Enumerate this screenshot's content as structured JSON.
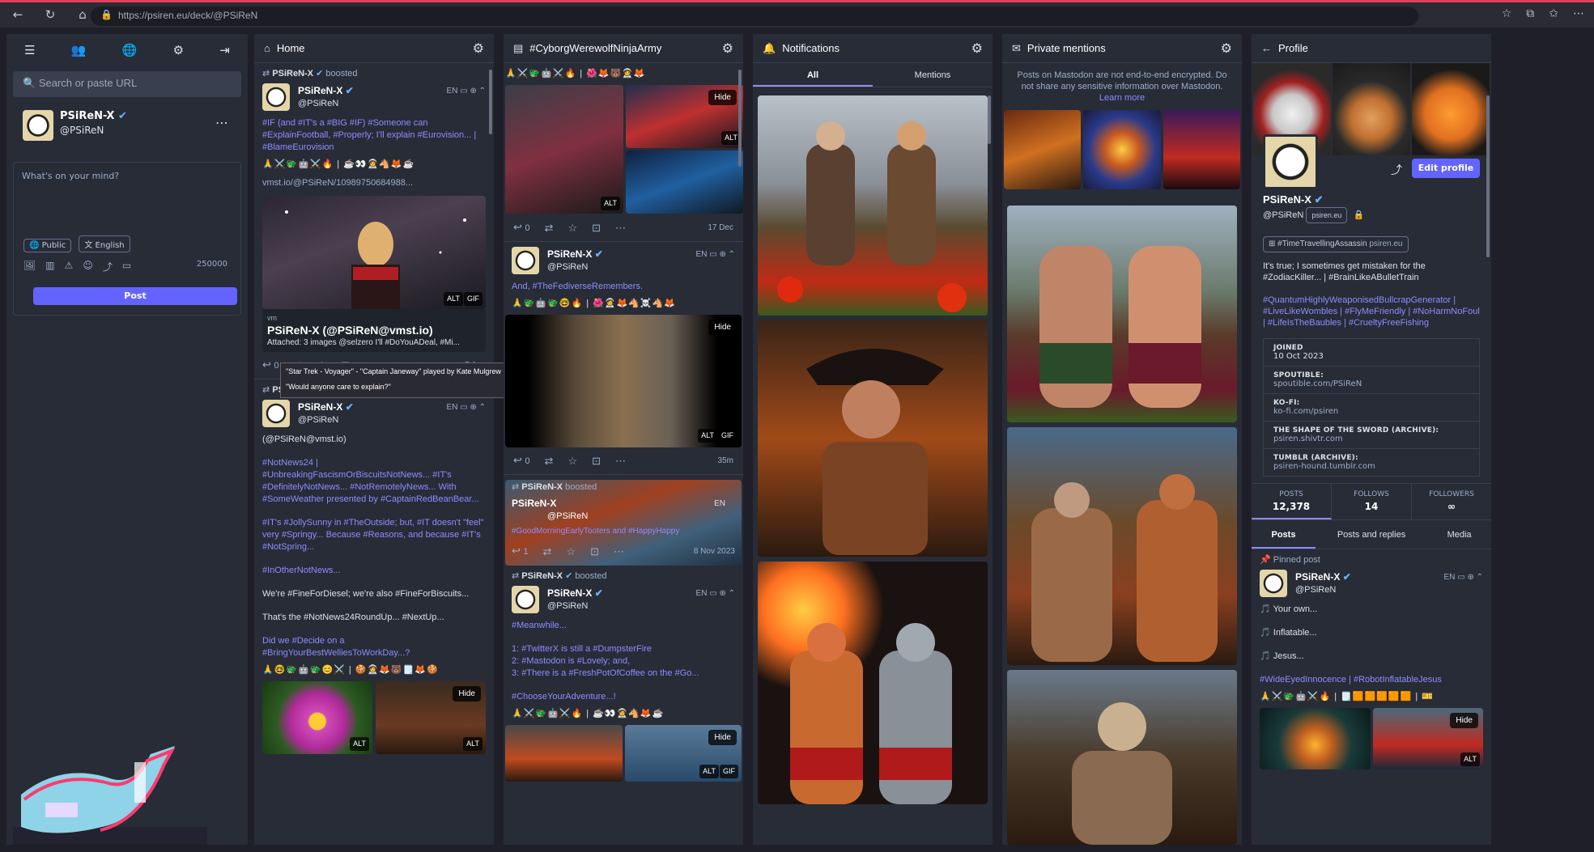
{
  "browser": {
    "url": "https://psiren.eu/deck/@PSiReN"
  },
  "nav": {
    "search_placeholder": "Search or paste URL"
  },
  "account": {
    "name": "PSiReN-X",
    "handle": "@PSiReN"
  },
  "compose": {
    "placeholder": "What's on your mind?",
    "visibility": "Public",
    "language": "English",
    "char_count": "250000",
    "post_label": "Post"
  },
  "columns": {
    "home": {
      "title": "Home"
    },
    "tag": {
      "title": "#CyborgWerewolfNinjaArmy"
    },
    "notifications": {
      "title": "Notifications",
      "tab_all": "All",
      "tab_mentions": "Mentions"
    },
    "mentions": {
      "title": "Private mentions",
      "notice": "Posts on Mastodon are not end-to-end encrypted. Do not share any sensitive information over Mastodon.",
      "learn_more": "Learn more"
    },
    "profile": {
      "title": "Profile"
    }
  },
  "home": {
    "p1": {
      "boost": "PSiReN-X",
      "boosted": "boosted",
      "name": "PSiReN-X",
      "handle": "@PSiReN",
      "lang": "EN",
      "text": "#IF (and #IT's a #BIG #IF) #Someone can #ExplainFootball, #Properly; I'll explain #Eurovision... | #BlameEurovision",
      "emoji": "🙏⚔️🐲🤖⚔️🔥 | ☕👀🧑‍🚀🐴🦊☕",
      "link": "vmst.io/@PSiReN/10989750684988...",
      "card_title": "PSiReN-X (@PSiReN@vmst.io)",
      "card_text": "Attached: 3 images @selzero I'll #DoYouADeal, #Mi...",
      "card_domain": "vm",
      "replies": "0",
      "date": "5 Aug"
    },
    "p2": {
      "boost": "PSiReN-X",
      "boosted": "boosted",
      "name": "PSiReN-X",
      "handle": "@PSiReN",
      "lang": "EN",
      "line1": "(@PSiReN@vmst.io)",
      "line2": "#NotNews24 | #UnbreakingFascismOrBiscuitsNotNews... #IT's #DefinitelyNotNews... #NotRemotelyNews... With #SomeWeather presented by #CaptainRedBeanBear...",
      "line3": "#IT's #JollySunny in #TheOutside; but, #IT doesn't \"feel\" very #Springy... Because #Reasons, and because #IT's #NotSpring...",
      "line4": "#InOtherNotNews...",
      "line5": "We're #FineForDiesel; we're also #FineForBiscuits...",
      "line6": "That's the #NotNews24RoundUp... #NextUp...",
      "line7": "Did we #Decide on a #BringYourBestWelliesToWorkDay...?",
      "emoji": "🙏🤓🐲🤖🐲😊⚔️ | 🍪🧑‍🚀🦊🐻🗒️🦊🍪"
    }
  },
  "tooltip": {
    "line1": "\"Star Trek - Voyager\" - \"Captain Janeway\" played by Kate Mulgrew",
    "line2": "\"Would anyone care to explain?\""
  },
  "tagcol": {
    "emoji1": "🙏⚔️🐲🤖⚔️🔥 | 🌺🦊🐻🧑‍🚀🦊",
    "p1": {
      "replies": "0",
      "date": "17 Dec"
    },
    "p2": {
      "name": "PSiReN-X",
      "handle": "@PSiReN",
      "lang": "EN",
      "text": "And, #TheFediverseRemembers.",
      "emoji": "🙏🐲🤖🐲🤓🔥 | 🌺🧑‍🚀🦊🐴☠️🐴🦊",
      "replies": "0",
      "date": "35m"
    },
    "p3": {
      "boost": "PSiReN-X",
      "boosted": "boosted",
      "name": "PSiReN-X",
      "handle": "@PSiReN",
      "lang": "EN",
      "text": "#GoodMorningEarlyTooters and #HappyHappy",
      "replies": "1",
      "date": "8 Nov 2023"
    },
    "p4": {
      "boost": "PSiReN-X",
      "boosted": "boosted",
      "name": "PSiReN-X",
      "handle": "@PSiReN",
      "lang": "EN",
      "l1": "#Meanwhile...",
      "l2": "1: #TwitterX is still a #DumpsterFire",
      "l3": "2: #Mastodon is #Lovely; and,",
      "l4": "3: #There is a #FreshPotOfCoffee on the #Go...",
      "l5": "#ChooseYourAdventure...!",
      "emoji": "🙏⚔️🐲🤖⚔️🔥 | ☕👀🧑‍🚀🐴🦊☕"
    }
  },
  "media": {
    "hide": "Hide",
    "alt": "ALT",
    "gif": "GIF"
  },
  "profile": {
    "name": "PSiReN-X",
    "handle": "@PSiReN",
    "domain": "psiren.eu",
    "edit": "Edit profile",
    "tag": "#TimeTravellingAssassin",
    "tag_domain": "psiren.eu",
    "bio1": "It's true; I sometimes get mistaken for the #ZodiacKiller... | #BrainLikeABulletTrain",
    "bio2": "#QuantumHighlyWeaponisedBullcrapGenerator | #LiveLikeWombles | #FlyMeFriendly | #NoHarmNoFoul | #LifeIsTheBaubles | #CrueltyFreeFishing",
    "fields": [
      {
        "k": "JOINED",
        "v": "10 Oct 2023"
      },
      {
        "k": "SPOUTIBLE:",
        "v": "spoutible.com/PSiReN"
      },
      {
        "k": "KO-FI:",
        "v": "ko-fi.com/psiren"
      },
      {
        "k": "THE SHAPE OF THE SWORD (ARCHIVE):",
        "v": "psiren.shivtr.com"
      },
      {
        "k": "TUMBLR (ARCHIVE):",
        "v": "psiren-hound.tumblr.com"
      }
    ],
    "stats": {
      "posts_label": "POSTS",
      "posts": "12,378",
      "follows_label": "FOLLOWS",
      "follows": "14",
      "followers_label": "FOLLOWERS",
      "followers": "∞"
    },
    "tabs": {
      "posts": "Posts",
      "replies": "Posts and replies",
      "media": "Media"
    },
    "pinned": "Pinned post",
    "pin_post": {
      "name": "PSiReN-X",
      "handle": "@PSiReN",
      "lang": "EN",
      "l1": "Your own...",
      "l2": "Inflatable...",
      "l3": "Jesus...",
      "l4": "#WideEyedInnocence | #RobotInflatableJesus",
      "emoji": "🙏⚔️🐲🤖⚔️🔥 | 🗒️🟧🟧🟧🟧🟧 | 🎫"
    }
  },
  "colors": {
    "accent": "#6364ff",
    "link": "#8c8dff",
    "bg": "#282c37",
    "deck": "#1f1f2a"
  }
}
